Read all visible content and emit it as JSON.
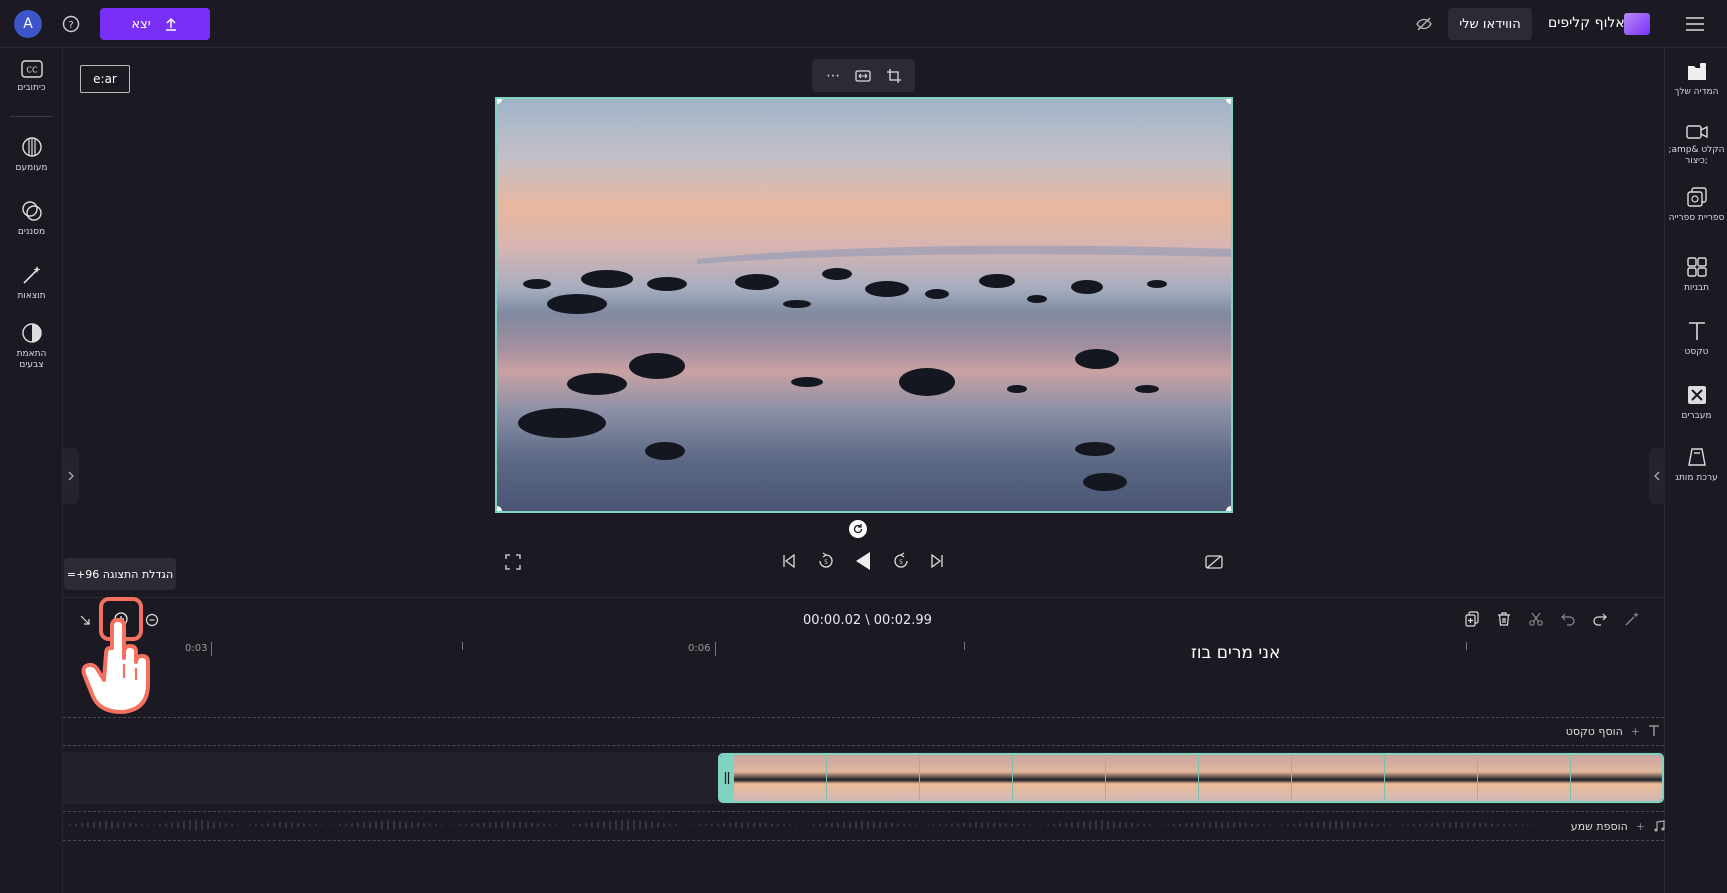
{
  "app": {
    "name": "אלוף קליפים",
    "my_video_label": "הווידאו שלי",
    "export_label": "יצא",
    "avatar_initial": "A"
  },
  "aspect_label": "e:ar",
  "left_sidebar": [
    {
      "label": "כיתובים",
      "icon": "captions-icon"
    },
    {
      "label": "מעומעם",
      "icon": "fade-icon"
    },
    {
      "label": "מסננים",
      "icon": "filters-icon"
    },
    {
      "label": "תוצאות",
      "icon": "effects-icon"
    },
    {
      "label": "התאמת צבעים",
      "icon": "color-adjust-icon"
    }
  ],
  "right_sidebar": [
    {
      "label": "המדיה שלך",
      "icon": "folder-icon"
    },
    {
      "label": "הקלט &amp; ;כיצור",
      "icon": "record-icon"
    },
    {
      "label": "ספריית ספרייה",
      "icon": "library-icon"
    },
    {
      "label": "תבניות",
      "icon": "templates-icon"
    },
    {
      "label": "טקסט",
      "icon": "text-icon"
    },
    {
      "label": "מעברים",
      "icon": "transitions-icon"
    },
    {
      "label": "ערכת מותג",
      "icon": "brand-kit-icon"
    }
  ],
  "timeline": {
    "tooltip": "הגדלת התצוגה 96+=",
    "time_readout": "00:00.02 \\ 00:02.99",
    "title": "אני מרים בוז",
    "ticks": [
      "0:03",
      "0:06"
    ],
    "add_text_label": "הוסף טקסט",
    "add_audio_label": "הוספת שמע",
    "clip_frames": 10
  },
  "colors": {
    "accent": "#7a2ff7",
    "selection": "#7fd3c0"
  }
}
